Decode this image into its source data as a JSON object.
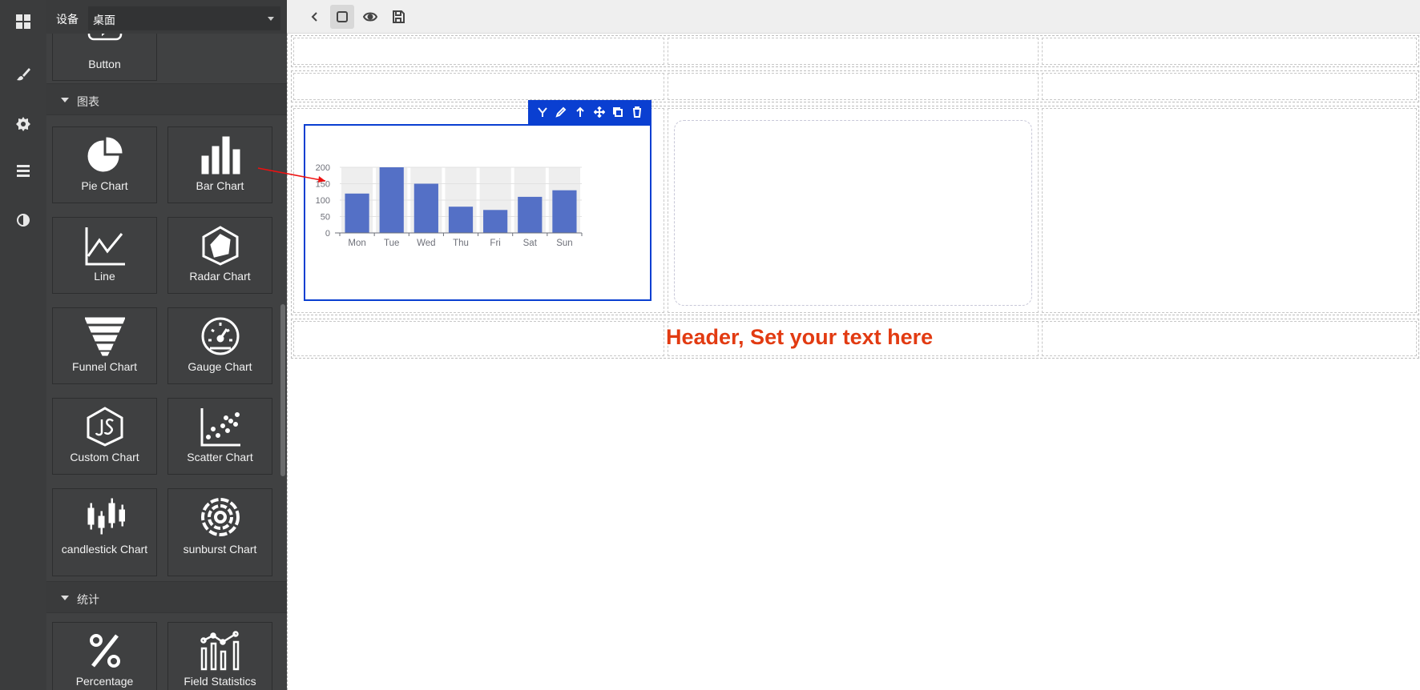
{
  "device": {
    "label": "设备",
    "selected": "桌面"
  },
  "rail": {
    "icons": [
      "dashboard-icon",
      "brush-icon",
      "gear-icon",
      "menu-icon",
      "contrast-icon"
    ]
  },
  "components": {
    "top_tile_label": "Button",
    "sections": [
      {
        "title": "图表",
        "items": [
          "Pie Chart",
          "Bar Chart",
          "Line",
          "Radar Chart",
          "Funnel Chart",
          "Gauge Chart",
          "Custom Chart",
          "Scatter Chart",
          "candlestick Chart",
          "sunburst Chart"
        ]
      },
      {
        "title": "统计",
        "items": [
          "Percentage",
          "Field Statistics"
        ]
      }
    ]
  },
  "toolbar": {
    "buttons": [
      "back-icon",
      "device-icon",
      "preview-icon",
      "save-icon"
    ]
  },
  "canvas": {
    "header_text": "Header, Set your text here",
    "element_tools": [
      "merge-icon",
      "edit-icon",
      "arrow-up-icon",
      "move-icon",
      "copy-icon",
      "delete-icon"
    ]
  },
  "chart_data": {
    "type": "bar",
    "categories": [
      "Mon",
      "Tue",
      "Wed",
      "Thu",
      "Fri",
      "Sat",
      "Sun"
    ],
    "values": [
      120,
      200,
      150,
      80,
      70,
      110,
      130
    ],
    "ylim": [
      0,
      200
    ],
    "yticks": [
      "0",
      "50",
      "100",
      "150",
      "200"
    ],
    "bar_color": "#5470c6",
    "background_bars": true
  },
  "colors": {
    "selection": "#0a3fd1",
    "header_text": "#e23b12",
    "panel": "#404142",
    "rail": "#3b3c3d"
  }
}
